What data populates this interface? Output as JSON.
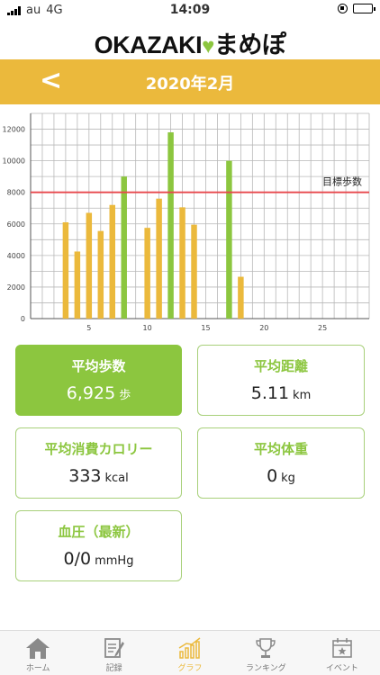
{
  "status_bar": {
    "carrier": "au",
    "network": "4G",
    "time": "14:09"
  },
  "app": {
    "logo_text": "OKAZAKI",
    "logo_text2": "まめぽ"
  },
  "header": {
    "back_label": "<",
    "title": "2020年2月"
  },
  "chart_data": {
    "type": "bar",
    "x": [
      3,
      4,
      5,
      6,
      7,
      8,
      10,
      11,
      12,
      13,
      14,
      17,
      18
    ],
    "values": [
      6100,
      4250,
      6700,
      5550,
      7200,
      9000,
      5750,
      7600,
      11800,
      7050,
      5950,
      10000,
      2650
    ],
    "goal_reached": [
      false,
      false,
      false,
      false,
      false,
      true,
      false,
      false,
      true,
      false,
      false,
      true,
      false
    ],
    "xlim": [
      0,
      29
    ],
    "ylim": [
      0,
      13000
    ],
    "xticks": [
      5,
      10,
      15,
      20,
      25
    ],
    "yticks": [
      0,
      2000,
      4000,
      6000,
      8000,
      10000,
      12000
    ],
    "goal_value": 8000,
    "goal_label": "目標歩数",
    "grid": true,
    "colors": {
      "bar": "#ebb93c",
      "bar_goal": "#8cc63f",
      "goal_line": "#e8474c",
      "grid": "#b8b8b8"
    }
  },
  "stats": {
    "avg_steps": {
      "label": "平均歩数",
      "value": "6,925",
      "unit": "歩"
    },
    "avg_distance": {
      "label": "平均距離",
      "value": "5.11",
      "unit": "km"
    },
    "avg_calories": {
      "label": "平均消費カロリー",
      "value": "333",
      "unit": "kcal"
    },
    "avg_weight": {
      "label": "平均体重",
      "value": "0",
      "unit": "kg"
    },
    "blood_pressure": {
      "label": "血圧（最新）",
      "value": "0/0",
      "unit": "mmHg"
    }
  },
  "tabs": [
    {
      "label": "ホーム",
      "icon": "home-icon"
    },
    {
      "label": "記録",
      "icon": "record-icon"
    },
    {
      "label": "グラフ",
      "icon": "graph-icon"
    },
    {
      "label": "ランキング",
      "icon": "trophy-icon"
    },
    {
      "label": "イベント",
      "icon": "calendar-icon"
    }
  ],
  "colors": {
    "accent": "#ebb93c",
    "green": "#8cc63f"
  }
}
